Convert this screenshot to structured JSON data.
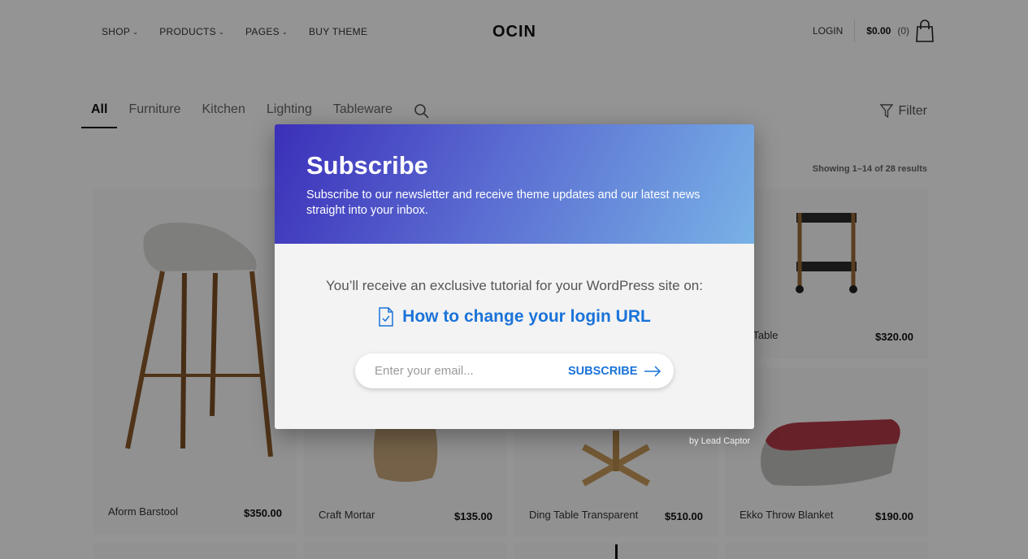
{
  "header": {
    "nav": [
      {
        "label": "SHOP",
        "has_dropdown": true
      },
      {
        "label": "PRODUCTS",
        "has_dropdown": true
      },
      {
        "label": "PAGES",
        "has_dropdown": true
      },
      {
        "label": "BUY THEME",
        "has_dropdown": false
      }
    ],
    "logo": "OCIN",
    "login": "LOGIN",
    "cart_total": "$0.00",
    "cart_count": "(0)"
  },
  "catalog": {
    "tabs": [
      "All",
      "Furniture",
      "Kitchen",
      "Lighting",
      "Tableware"
    ],
    "active_tab": "All",
    "filter_label": "Filter",
    "results_text": "Showing 1–14 of 28 results",
    "products": [
      {
        "name": "Aform Barstool",
        "price": "$350.00"
      },
      {
        "name": "Craft Mortar",
        "price": "$135.00"
      },
      {
        "name": "Ding Table Transparent",
        "price": "$510.00"
      },
      {
        "name": "Ekko Throw Blanket",
        "price": "$190.00"
      },
      {
        "name": "ck Table",
        "price": "$320.00"
      }
    ]
  },
  "popup": {
    "title": "Subscribe",
    "subtitle": "Subscribe to our newsletter and receive theme updates and our latest news straight into your inbox.",
    "lead": "You’ll receive an exclusive tutorial for your WordPress site on:",
    "link_text": "How to change your login URL",
    "email_placeholder": "Enter your email...",
    "button_label": "SUBSCRIBE",
    "credit": "by Lead Captor",
    "accent_color": "#1a73d9",
    "gradient_colors": [
      "#3b2fb9",
      "#78b2e6"
    ]
  }
}
